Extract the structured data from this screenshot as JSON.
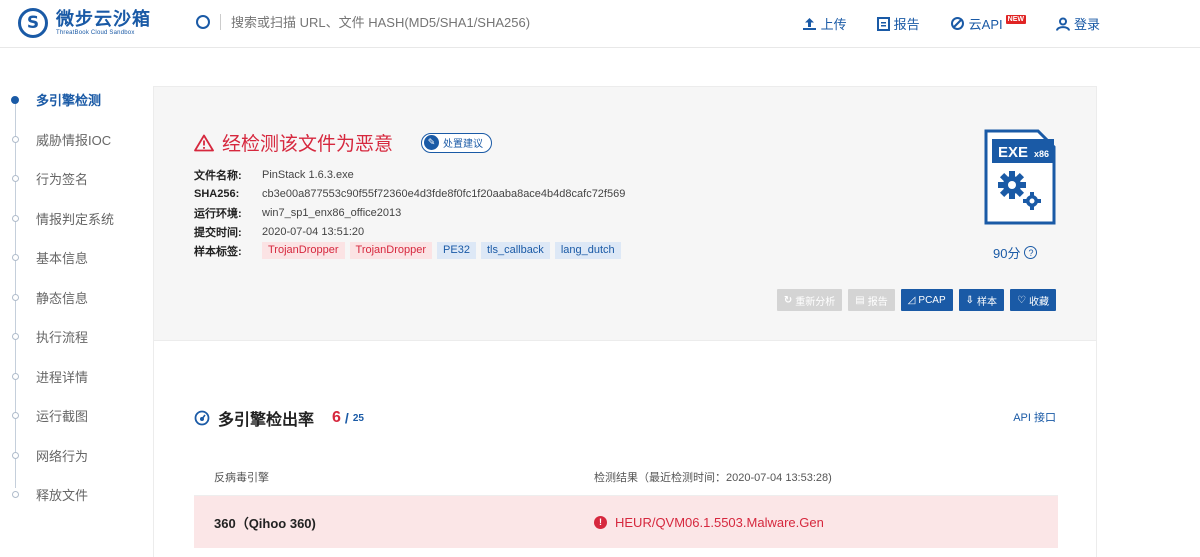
{
  "header": {
    "logo_cn": "微步云沙箱",
    "logo_en": "ThreatBook Cloud Sandbox",
    "search_placeholder": "搜索或扫描 URL、文件 HASH(MD5/SHA1/SHA256)",
    "nav": [
      {
        "label": "上传",
        "icon": "upload-icon"
      },
      {
        "label": "报告",
        "icon": "report-icon"
      },
      {
        "label": "云API",
        "icon": "api-icon",
        "badge": "NEW"
      },
      {
        "label": "登录",
        "icon": "user-icon"
      }
    ]
  },
  "sidebar": {
    "items": [
      {
        "label": "多引擎检测",
        "active": true
      },
      {
        "label": "威胁情报IOC"
      },
      {
        "label": "行为签名"
      },
      {
        "label": "情报判定系统"
      },
      {
        "label": "基本信息"
      },
      {
        "label": "静态信息"
      },
      {
        "label": "执行流程"
      },
      {
        "label": "进程详情"
      },
      {
        "label": "运行截图"
      },
      {
        "label": "网络行为"
      },
      {
        "label": "释放文件"
      }
    ]
  },
  "summary": {
    "verdict": "经检测该文件为恶意",
    "advice_label": "处置建议",
    "file_name_label": "文件名称:",
    "file_name": "PinStack 1.6.3.exe",
    "sha256_label": "SHA256:",
    "sha256": "cb3e00a877553c90f55f72360e4d3fde8f0fc1f20aaba8ace4b4d8cafc72f569",
    "env_label": "运行环境:",
    "env": "win7_sp1_enx86_office2013",
    "submit_label": "提交时间:",
    "submit_time": "2020-07-04 13:51:20",
    "tags_label": "样本标签:",
    "tags": [
      {
        "text": "TrojanDropper",
        "kind": "red"
      },
      {
        "text": "TrojanDropper",
        "kind": "red"
      },
      {
        "text": "PE32",
        "kind": "blue"
      },
      {
        "text": "tls_callback",
        "kind": "blue"
      },
      {
        "text": "lang_dutch",
        "kind": "blue"
      }
    ],
    "file_type": "EXE",
    "file_arch": "x86",
    "score": "90分",
    "colors": {
      "malicious": "#d6283e",
      "brand": "#1a5aa6"
    }
  },
  "actions": [
    {
      "label": "重新分析",
      "icon": "refresh-icon",
      "glyph": "↻",
      "disabled": true
    },
    {
      "label": "报告",
      "icon": "report-icon",
      "glyph": "▤",
      "disabled": true
    },
    {
      "label": "PCAP",
      "icon": "pcap-icon",
      "glyph": "◿",
      "disabled": false
    },
    {
      "label": "样本",
      "icon": "download-icon",
      "glyph": "⇩",
      "disabled": false
    },
    {
      "label": "收藏",
      "icon": "heart-icon",
      "glyph": "♡",
      "disabled": false
    }
  ],
  "detection": {
    "title": "多引擎检出率",
    "detected": "6",
    "slash": "/",
    "total": "25",
    "api_link": "API 接口",
    "col_engine": "反病毒引擎",
    "col_result": "检测结果（最近检测时间：2020-07-04 13:53:28)",
    "rows": [
      {
        "engine": "360（Qihoo 360)",
        "result": "HEUR/QVM06.1.5503.Malware.Gen"
      }
    ]
  }
}
